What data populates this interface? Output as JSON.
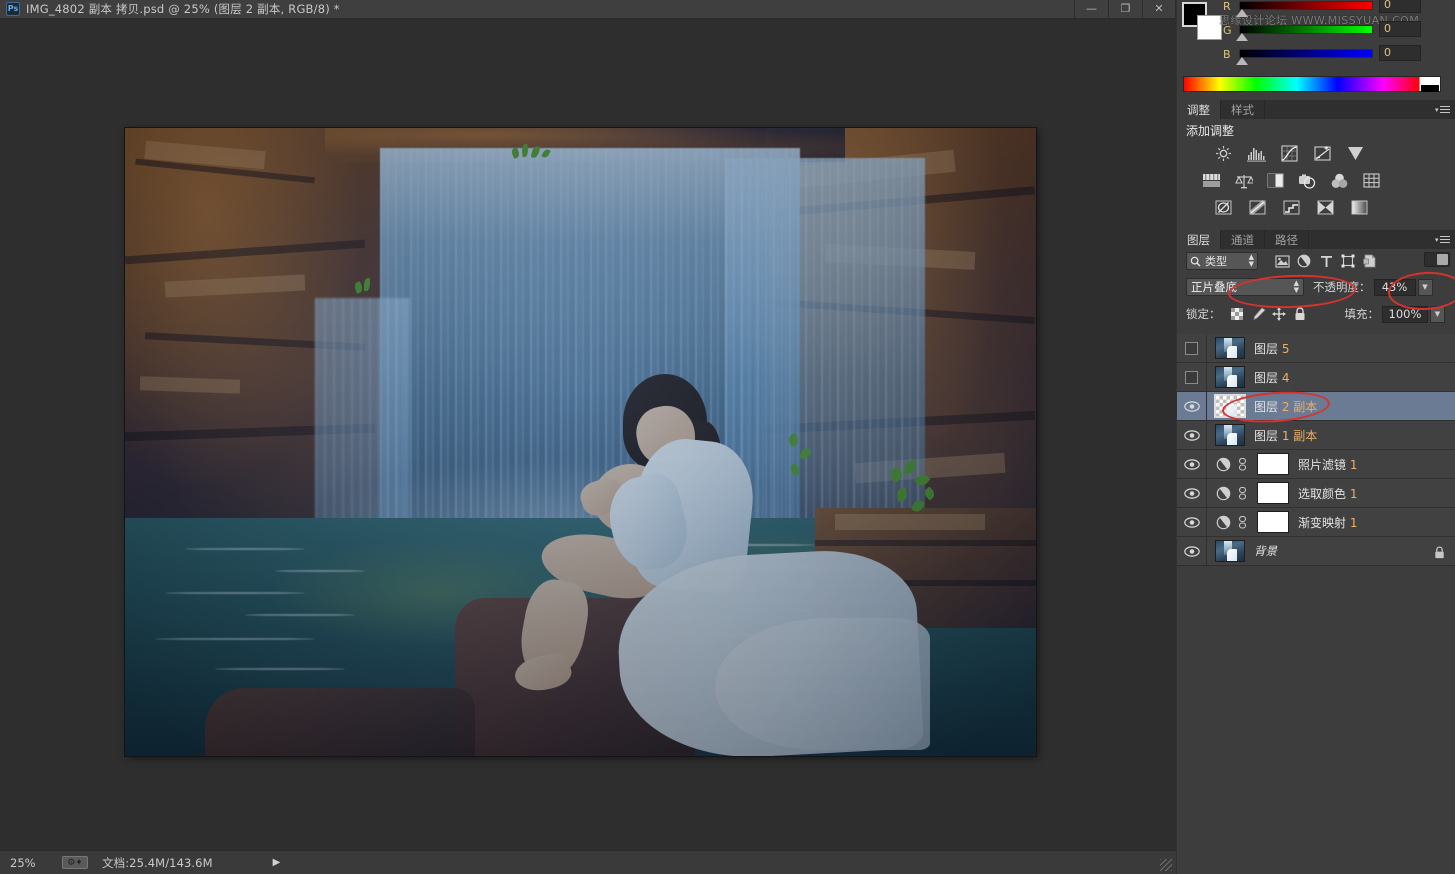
{
  "window": {
    "app_icon": "photoshop-icon",
    "title": "IMG_4802 副本 拷贝.psd @ 25% (图层 2 副本, RGB/8) *",
    "minimize": "—",
    "maximize": "❐",
    "close": "✕"
  },
  "status": {
    "zoom": "25%",
    "doc_icon": "document-profile-icon",
    "doc_size": "文档:25.4M/143.6M",
    "arrow": "▶"
  },
  "color_panel": {
    "watermark": "思缘设计论坛 WWW.MISSYUAN.COM",
    "foreground": "#000000",
    "background": "#ffffff",
    "channels": [
      {
        "label": "R",
        "value": "0"
      },
      {
        "label": "G",
        "value": "0"
      },
      {
        "label": "B",
        "value": "0"
      }
    ]
  },
  "adjustments_panel": {
    "tabs": [
      {
        "label": "调整",
        "active": true
      },
      {
        "label": "样式",
        "active": false
      }
    ],
    "title": "添加调整",
    "rows": [
      [
        "brightness-contrast-icon",
        "levels-icon",
        "curves-icon",
        "exposure-icon",
        "vibrance-icon"
      ],
      [
        "hue-saturation-icon",
        "color-balance-icon",
        "black-white-icon",
        "photo-filter-icon",
        "channel-mixer-icon",
        "color-lookup-icon"
      ],
      [
        "invert-icon",
        "posterize-icon",
        "threshold-icon",
        "selective-color-icon",
        "gradient-map-icon"
      ]
    ]
  },
  "layers_panel": {
    "tabs": [
      {
        "label": "图层",
        "active": true
      },
      {
        "label": "通道",
        "active": false
      },
      {
        "label": "路径",
        "active": false
      }
    ],
    "filter": {
      "kind_label": "类型",
      "search_icon": "search-icon",
      "type_icons": [
        "filter-pixel-icon",
        "filter-adjustment-icon",
        "filter-type-icon",
        "filter-shape-icon",
        "filter-smartobject-icon"
      ],
      "toggle": "filter-enable-toggle"
    },
    "blend_mode": "正片叠底",
    "opacity_label": "不透明度：",
    "opacity_value": "43%",
    "lock_label": "锁定：",
    "lock_icons": [
      "lock-transparency-icon",
      "lock-image-icon",
      "lock-position-icon",
      "lock-all-icon"
    ],
    "fill_label": "填充：",
    "fill_value": "100%",
    "layers": [
      {
        "name": "图层 ",
        "num": "5",
        "visible": false,
        "selected": false,
        "type": "pixel"
      },
      {
        "name": "图层 ",
        "num": "4",
        "visible": false,
        "selected": false,
        "type": "pixel"
      },
      {
        "name": "图层 ",
        "num": "2 副本",
        "visible": true,
        "selected": true,
        "type": "pixel-transparent"
      },
      {
        "name": "图层 ",
        "num": "1 副本",
        "visible": true,
        "selected": false,
        "type": "pixel"
      },
      {
        "name": "照片滤镜 ",
        "num": "1",
        "visible": true,
        "selected": false,
        "type": "adjustment"
      },
      {
        "name": "选取颜色 ",
        "num": "1",
        "visible": true,
        "selected": false,
        "type": "adjustment"
      },
      {
        "name": "渐变映射 ",
        "num": "1",
        "visible": true,
        "selected": false,
        "type": "adjustment"
      },
      {
        "name": "背景",
        "num": "",
        "visible": true,
        "selected": false,
        "type": "background",
        "locked": true
      }
    ]
  },
  "annotations": {
    "color": "#d6322e",
    "marks": [
      "blend-mode-ellipse",
      "opacity-ellipse",
      "selected-layer-ellipse"
    ]
  },
  "canvas": {
    "description": "waterfall-portrait-photo",
    "subject": "woman-in-white-dress-sitting-on-rock",
    "zoom": "25%"
  }
}
